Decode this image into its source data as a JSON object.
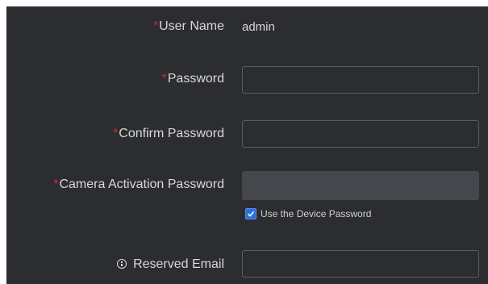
{
  "form": {
    "user_name": {
      "required_mark": "*",
      "label": "User Name",
      "value": "admin"
    },
    "password": {
      "required_mark": "*",
      "label": "Password",
      "value": ""
    },
    "confirm_password": {
      "required_mark": "*",
      "label": "Confirm Password",
      "value": ""
    },
    "camera_activation_password": {
      "required_mark": "*",
      "label": "Camera Activation Password",
      "value": "",
      "disabled": true
    },
    "use_device_password": {
      "label": "Use the Device Password",
      "checked": true
    },
    "reserved_email": {
      "icon": "info-icon",
      "label": "Reserved Email",
      "value": ""
    }
  },
  "colors": {
    "background": "#2b2d31",
    "text": "#d8d8d8",
    "required": "#d12b2b",
    "field_border": "#5a5c61",
    "disabled_field": "#45474c",
    "checkbox_accent": "#2f6fd6"
  }
}
